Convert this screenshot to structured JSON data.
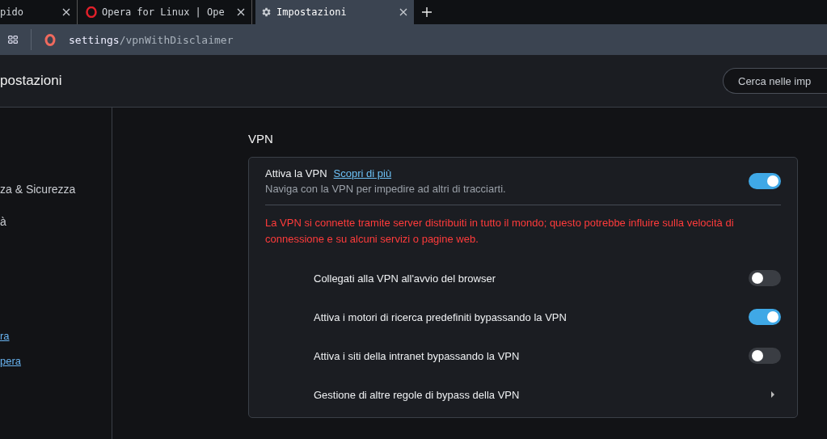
{
  "tabs": [
    {
      "title": "pido",
      "kind": "plain",
      "selected": false
    },
    {
      "title": "Opera for Linux | Ope",
      "kind": "opera",
      "selected": false
    },
    {
      "title": "Impostazioni",
      "kind": "settings",
      "selected": true
    }
  ],
  "address_bar": {
    "host": "settings",
    "path": "/vpnWithDisclaimer"
  },
  "header": {
    "title": "postazioni",
    "search": {
      "placeholder": "Cerca nelle imp"
    }
  },
  "sidebar": {
    "items": [
      {
        "label": "za & Sicurezza",
        "kind": "item"
      },
      {
        "label": "à",
        "kind": "item"
      },
      {
        "label": "ra",
        "kind": "link"
      },
      {
        "label": "pera",
        "kind": "link"
      }
    ]
  },
  "section": {
    "title": "VPN",
    "main": {
      "label": "Attiva la VPN",
      "link": "Scopri di più",
      "description": "Naviga con la VPN per impedire ad altri di tracciarti.",
      "on": true
    },
    "warning": "La VPN si connette tramite server distribuiti in tutto il mondo; questo potrebbe influire sulla velocità di connessione e su alcuni servizi o pagine web.",
    "rows": [
      {
        "label": "Collegati alla VPN all'avvio del browser",
        "kind": "toggle",
        "on": false
      },
      {
        "label": "Attiva i motori di ricerca predefiniti bypassando la VPN",
        "kind": "toggle",
        "on": true
      },
      {
        "label": "Attiva i siti della intranet bypassando la VPN",
        "kind": "toggle",
        "on": false
      },
      {
        "label": "Gestione di altre regole di bypass della VPN",
        "kind": "link"
      }
    ]
  }
}
